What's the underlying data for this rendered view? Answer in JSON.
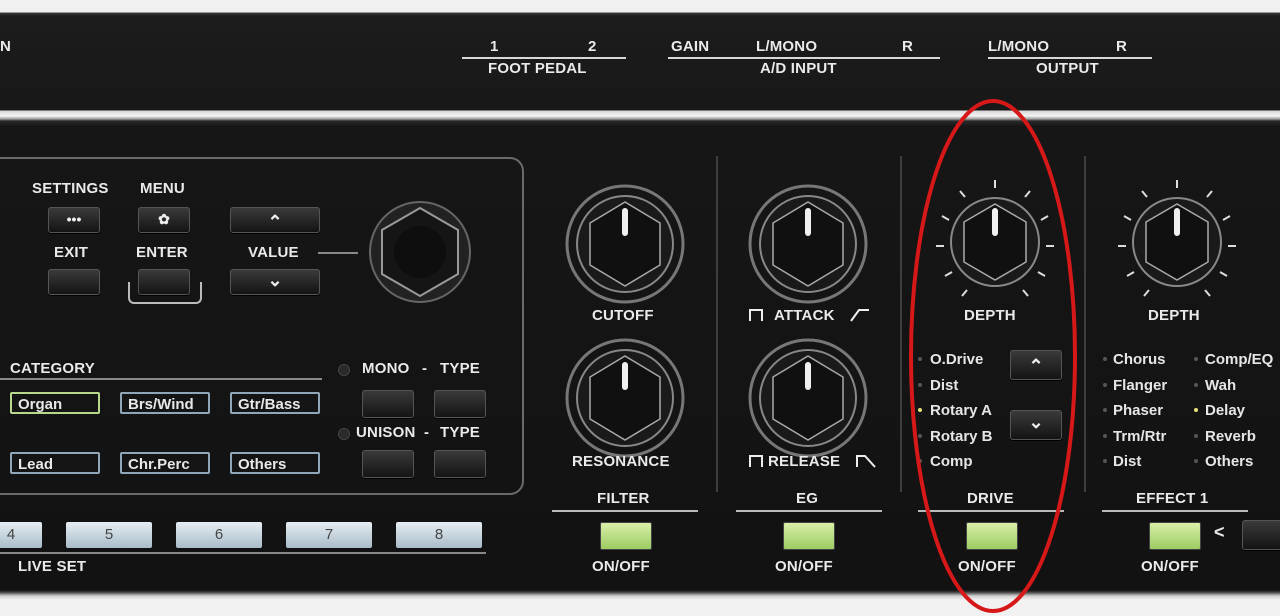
{
  "top": {
    "left_partial": "N",
    "foot_pedal": {
      "n1": "1",
      "n2": "2",
      "label": "FOOT PEDAL"
    },
    "ad_input": {
      "gain": "GAIN",
      "lmono": "L/MONO",
      "r": "R",
      "label": "A/D INPUT"
    },
    "output": {
      "lmono": "L/MONO",
      "r": "R",
      "label": "OUTPUT"
    }
  },
  "control": {
    "settings": "SETTINGS",
    "menu": "MENU",
    "exit": "EXIT",
    "enter": "ENTER",
    "value": "VALUE",
    "settings_glyph": "•••",
    "menu_glyph": "✿",
    "up_glyph": "⌃",
    "down_glyph": "⌄"
  },
  "category": {
    "title": "CATEGORY",
    "items": [
      "Organ",
      "Brs/Wind",
      "Gtr/Bass",
      "Lead",
      "Chr.Perc",
      "Others"
    ]
  },
  "mono": {
    "mono": "MONO",
    "dash": "-",
    "type": "TYPE",
    "unison": "UNISON",
    "dash2": "-",
    "type2": "TYPE"
  },
  "liveset": {
    "label": "LIVE SET",
    "buttons": [
      "4",
      "5",
      "6",
      "7",
      "8"
    ]
  },
  "filter": {
    "cutoff": "CUTOFF",
    "resonance": "RESONANCE",
    "label": "FILTER",
    "onoff": "ON/OFF"
  },
  "eg": {
    "attack": "ATTACK",
    "release": "RELEASE",
    "label": "EG",
    "onoff": "ON/OFF"
  },
  "drive": {
    "depth": "DEPTH",
    "label": "DRIVE",
    "onoff": "ON/OFF",
    "types": [
      "O.Drive",
      "Dist",
      "Rotary A",
      "Rotary B",
      "Comp"
    ],
    "selected_index": 2
  },
  "effect1": {
    "depth": "DEPTH",
    "label": "EFFECT 1",
    "onoff": "ON/OFF",
    "arrow": "<",
    "col1": [
      "Chorus",
      "Flanger",
      "Phaser",
      "Trm/Rtr",
      "Dist"
    ],
    "col2": [
      "Comp/EQ",
      "Wah",
      "Delay",
      "Reverb",
      "Others"
    ],
    "selected": "Delay"
  },
  "colors": {
    "highlight_ellipse": "#d61818",
    "onoff_green": "#b8e07a",
    "category_border": "#8fa7b8",
    "category_active": "#b9d98a"
  }
}
